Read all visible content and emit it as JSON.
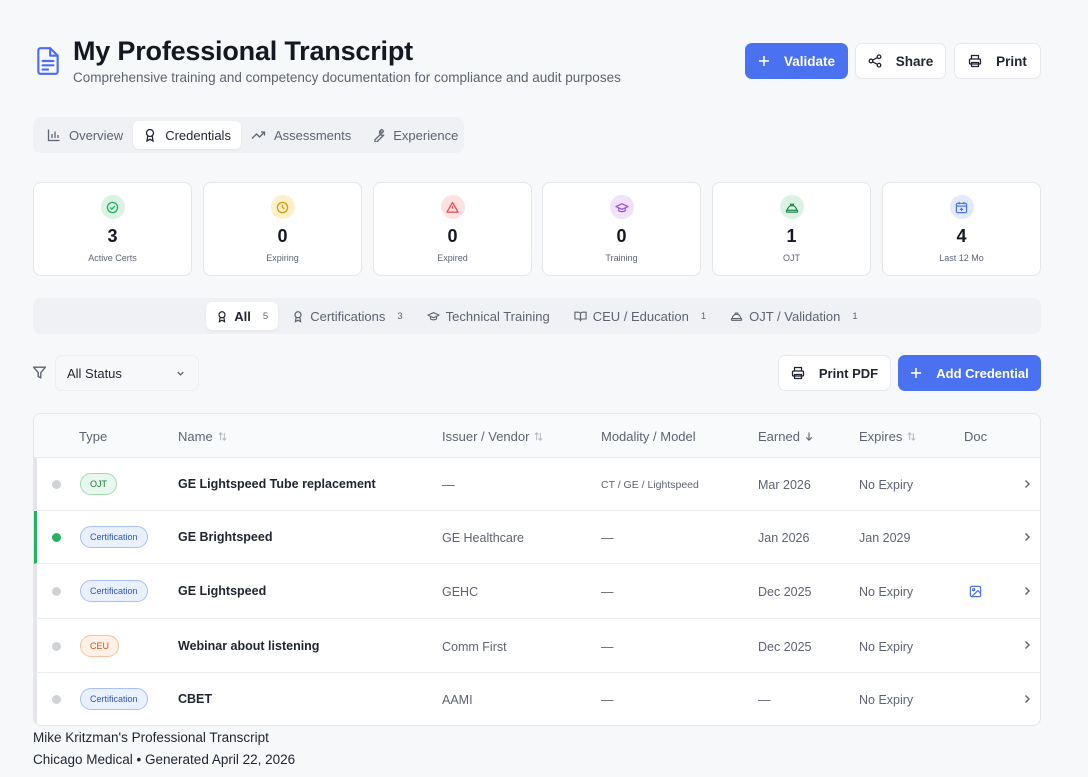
{
  "header": {
    "title": "My Professional Transcript",
    "subtitle": "Comprehensive training and competency documentation for compliance and audit purposes",
    "validate_label": "Validate",
    "share_label": "Share",
    "print_label": "Print",
    "accent_color": "#4a72f0"
  },
  "main_tabs": [
    {
      "label": "Overview",
      "icon": "bar-chart-icon",
      "active": false
    },
    {
      "label": "Credentials",
      "icon": "award-icon",
      "active": true
    },
    {
      "label": "Assessments",
      "icon": "trend-up-icon",
      "active": false
    },
    {
      "label": "Experience",
      "icon": "wrench-icon",
      "active": false
    }
  ],
  "stats": [
    {
      "value": "3",
      "label": "Active Certs",
      "icon": "check-circle-icon",
      "color": "#22b35e"
    },
    {
      "value": "0",
      "label": "Expiring",
      "icon": "clock-icon",
      "color": "#d99a0b"
    },
    {
      "value": "0",
      "label": "Expired",
      "icon": "alert-triangle-icon",
      "color": "#e5484d"
    },
    {
      "value": "0",
      "label": "Training",
      "icon": "graduation-cap-icon",
      "color": "#9b51e0"
    },
    {
      "value": "1",
      "label": "OJT",
      "icon": "hard-hat-icon",
      "color": "#22b35e"
    },
    {
      "value": "4",
      "label": "Last 12 Mo",
      "icon": "calendar-plus-icon",
      "color": "#4a72f0"
    }
  ],
  "filter_tabs": [
    {
      "label": "All",
      "count": "5",
      "icon": "award-icon",
      "active": true
    },
    {
      "label": "Certifications",
      "count": "3",
      "icon": "award-icon",
      "active": false
    },
    {
      "label": "Technical Training",
      "count": "",
      "icon": "graduation-cap-icon",
      "active": false
    },
    {
      "label": "CEU / Education",
      "count": "1",
      "icon": "book-open-icon",
      "active": false
    },
    {
      "label": "OJT / Validation",
      "count": "1",
      "icon": "hard-hat-icon",
      "active": false
    }
  ],
  "toolbar": {
    "status_value": "All Status",
    "print_pdf_label": "Print PDF",
    "add_credential_label": "Add Credential"
  },
  "table": {
    "headers": {
      "type": "Type",
      "name": "Name",
      "issuer": "Issuer / Vendor",
      "modality": "Modality / Model",
      "earned": "Earned",
      "expires": "Expires",
      "doc": "Doc"
    },
    "rows": [
      {
        "type": "OJT",
        "name": "GE Lightspeed Tube replacement",
        "issuer": "—",
        "modality": "CT / GE / Lightspeed",
        "earned": "Mar 2026",
        "expires": "No Expiry"
      },
      {
        "type": "Certification",
        "name": "GE Brightspeed",
        "issuer": "GE Healthcare",
        "modality": "—",
        "earned": "Jan 2026",
        "expires": "Jan 2029"
      },
      {
        "type": "Certification",
        "name": "GE Lightspeed",
        "issuer": "GEHC",
        "modality": "—",
        "earned": "Dec 2025",
        "expires": "No Expiry"
      },
      {
        "type": "CEU",
        "name": "Webinar about listening",
        "issuer": "Comm First",
        "modality": "—",
        "earned": "Dec 2025",
        "expires": "No Expiry"
      },
      {
        "type": "Certification",
        "name": "CBET",
        "issuer": "AAMI",
        "modality": "—",
        "earned": "—",
        "expires": "No Expiry"
      }
    ]
  },
  "footer": {
    "line1": "Mike Kritzman's Professional Transcript",
    "line2": "Chicago Medical • Generated April 22, 2026"
  }
}
